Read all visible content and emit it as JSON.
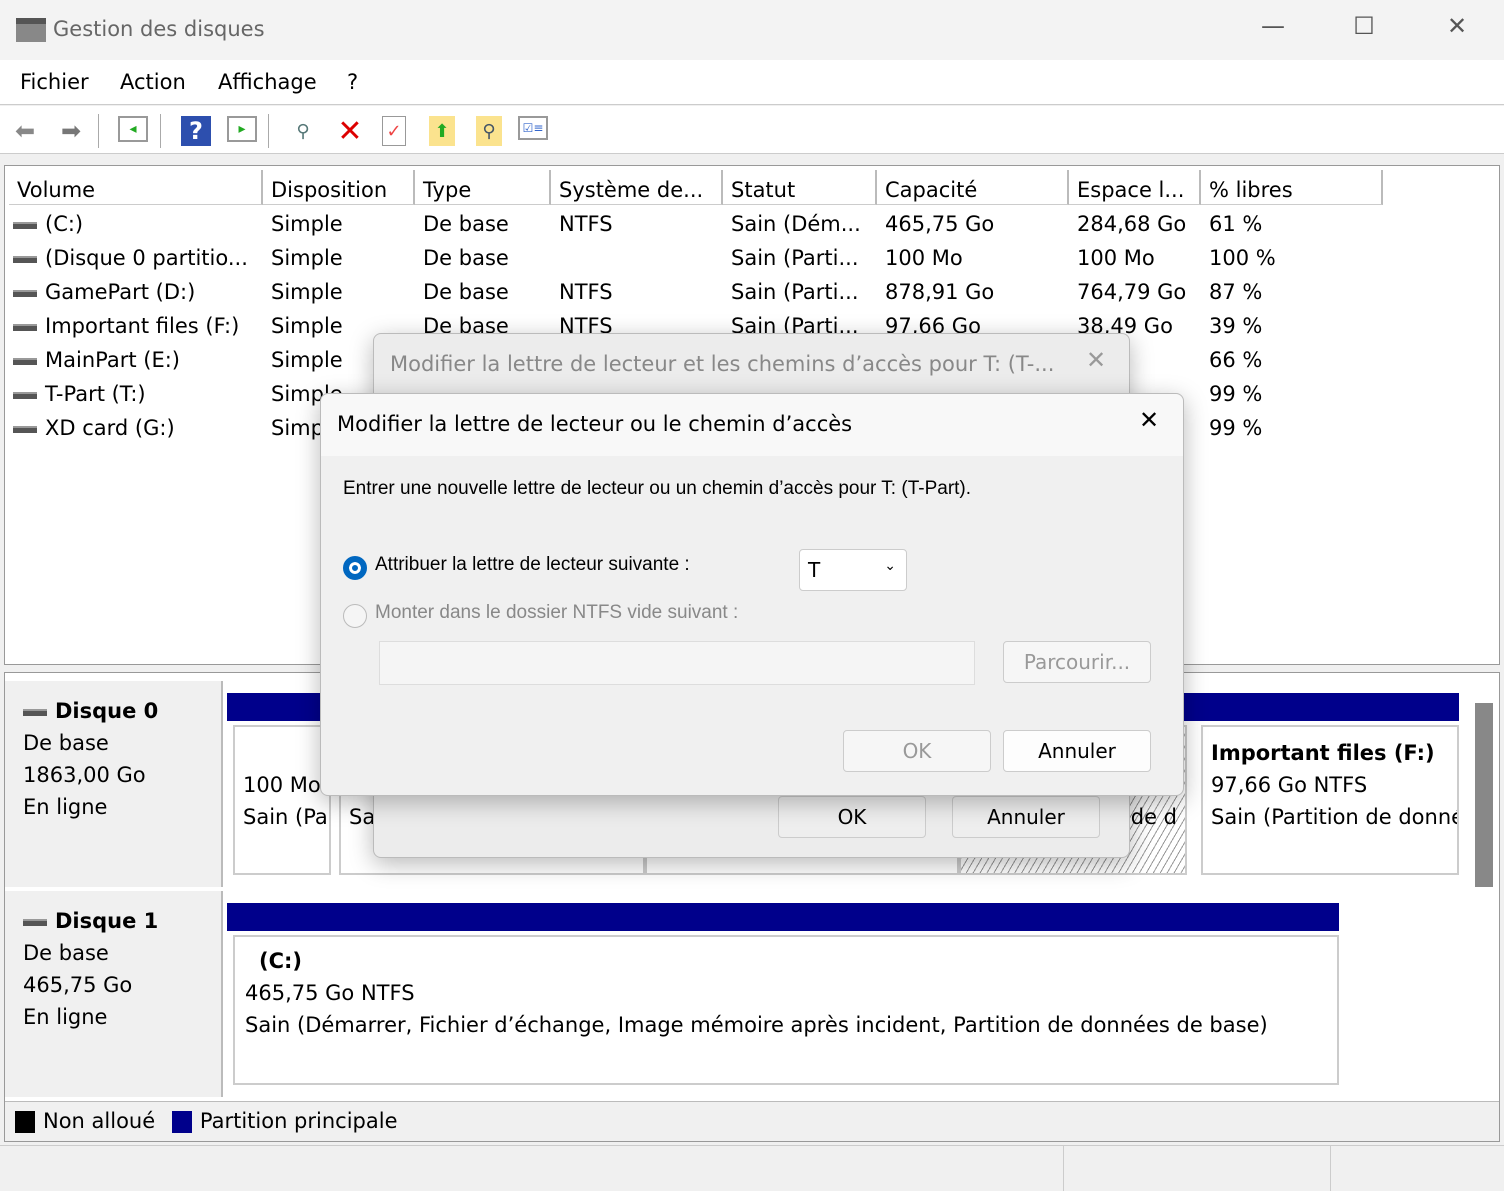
{
  "window": {
    "title": "Gestion des disques",
    "minimize": "—",
    "maximize": "☐",
    "close": "✕"
  },
  "menu": [
    "Fichier",
    "Action",
    "Affichage",
    "?"
  ],
  "toolbar": [
    "back-icon",
    "forward-icon",
    "show-hide-console-tree-icon",
    "help-icon",
    "show-hide-action-pane-icon",
    "connect-drive-icon",
    "delete-icon",
    "properties-icon",
    "export-icon",
    "search-icon",
    "list-icon"
  ],
  "table": {
    "headers": [
      "Volume",
      "Disposition",
      "Type",
      "Système de...",
      "Statut",
      "Capacité",
      "Espace l...",
      "% libres"
    ],
    "rows": [
      [
        "(C:)",
        "Simple",
        "De base",
        "NTFS",
        "Sain (Dém...",
        "465,75 Go",
        "284,68 Go",
        "61 %"
      ],
      [
        "(Disque 0 partitio...",
        "Simple",
        "De base",
        "",
        "Sain (Parti...",
        "100 Mo",
        "100 Mo",
        "100 %"
      ],
      [
        "GamePart (D:)",
        "Simple",
        "De base",
        "NTFS",
        "Sain (Parti...",
        "878,91 Go",
        "764,79 Go",
        "87 %"
      ],
      [
        "Important files (F:)",
        "Simple",
        "De base",
        "NTFS",
        "Sain (Parti...",
        "97,66 Go",
        "38,49 Go",
        "39 %"
      ],
      [
        "MainPart (E:)",
        "Simple",
        "",
        "",
        "",
        "",
        "",
        "66 %"
      ],
      [
        "T-Part (T:)",
        "Simple",
        "",
        "",
        "",
        "",
        "",
        "99 %"
      ],
      [
        "XD card (G:)",
        "Simple",
        "",
        "",
        "",
        "",
        "",
        "99 %"
      ]
    ]
  },
  "disks": [
    {
      "name": "Disque 0",
      "type": "De base",
      "size": "1863,00 Go",
      "status": "En ligne",
      "partitions": [
        {
          "line1": "100 Mo",
          "line2": "Sain (Partition"
        },
        {
          "line1": "",
          "line2": "Sain"
        },
        {
          "line1": "",
          "line2": "de d"
        },
        {
          "title": "Important files  (F:)",
          "line1": "97,66 Go NTFS",
          "line2": "Sain (Partition de données de base)"
        }
      ]
    },
    {
      "name": "Disque 1",
      "type": "De base",
      "size": "465,75 Go",
      "status": "En ligne",
      "partitions": [
        {
          "title": "(C:)",
          "line1": "465,75 Go NTFS",
          "line2": "Sain (Démarrer, Fichier d’échange, Image mémoire après incident, Partition de données de base)"
        }
      ]
    }
  ],
  "legend": [
    {
      "label": "Non alloué",
      "color": "#000000"
    },
    {
      "label": "Partition principale",
      "color": "#00008b"
    }
  ],
  "dialog_back": {
    "title": "Modifier la lettre de lecteur et les chemins d’accès pour T: (T-...",
    "ok": "OK",
    "cancel": "Annuler"
  },
  "dialog": {
    "title": "Modifier la lettre de lecteur ou le chemin d’accès",
    "prompt": "Entrer une nouvelle lettre de lecteur ou un chemin d’accès pour T: (T-Part).",
    "option_letter": "Attribuer la lettre de lecteur suivante :",
    "letter_value": "T",
    "option_folder": "Monter dans le dossier NTFS vide suivant :",
    "folder_value": "",
    "browse": "Parcourir...",
    "ok": "OK",
    "cancel": "Annuler",
    "selected": "letter"
  },
  "colors": {
    "accent": "#0067c0",
    "partition": "#00008b"
  }
}
